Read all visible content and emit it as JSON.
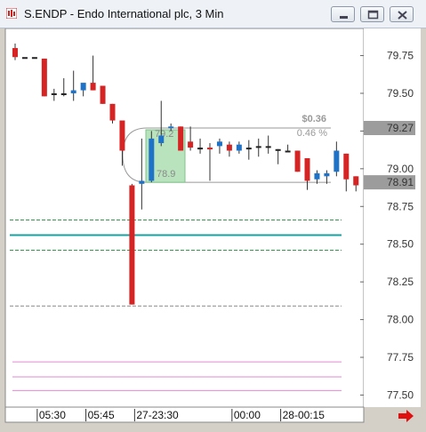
{
  "window": {
    "title": "S.ENDP - Endo International plc, 3 Min",
    "icon": "chart-app-icon",
    "buttons": [
      "minimize-icon",
      "maximize-icon",
      "close-icon"
    ]
  },
  "colors": {
    "up": "#1e73c9",
    "down": "#d62424",
    "neutral": "#222222",
    "green_band": "#2e9b4a",
    "teal": "#19a0a0",
    "pink": "#e28ad2",
    "gray_line": "#888888",
    "highlight_fill": "#b8e3bd"
  },
  "chart_data": {
    "type": "candlestick",
    "symbol": "S.ENDP",
    "interval": "3 Min",
    "ylim": [
      77.42,
      79.93
    ],
    "y_ticks": [
      "79.75",
      "79.50",
      "79.25",
      "79.00",
      "78.75",
      "78.50",
      "78.25",
      "78.00",
      "77.75",
      "77.50"
    ],
    "y_tick_values": [
      79.75,
      79.5,
      79.25,
      79.0,
      78.75,
      78.5,
      78.25,
      78.0,
      77.75,
      77.5
    ],
    "x_labels": [
      "05:30",
      "05:45",
      "27-23:30",
      "00:00",
      "28-00:15"
    ],
    "x_label_bars": [
      3,
      8,
      13,
      23,
      28
    ],
    "candles": [
      {
        "o": 79.8,
        "h": 79.83,
        "l": 79.72,
        "c": 79.74
      },
      {
        "o": 79.74,
        "h": 79.74,
        "l": 79.74,
        "c": 79.74
      },
      {
        "o": 79.74,
        "h": 79.74,
        "l": 79.74,
        "c": 79.74
      },
      {
        "o": 79.73,
        "h": 79.73,
        "l": 79.48,
        "c": 79.48
      },
      {
        "o": 79.5,
        "h": 79.53,
        "l": 79.45,
        "c": 79.5
      },
      {
        "o": 79.5,
        "h": 79.6,
        "l": 79.48,
        "c": 79.5
      },
      {
        "o": 79.5,
        "h": 79.65,
        "l": 79.45,
        "c": 79.52
      },
      {
        "o": 79.52,
        "h": 79.55,
        "l": 79.48,
        "c": 79.57
      },
      {
        "o": 79.57,
        "h": 79.75,
        "l": 79.52,
        "c": 79.52
      },
      {
        "o": 79.55,
        "h": 79.55,
        "l": 79.43,
        "c": 79.43
      },
      {
        "o": 79.43,
        "h": 79.43,
        "l": 79.3,
        "c": 79.32
      },
      {
        "o": 79.32,
        "h": 79.25,
        "l": 79.02,
        "c": 79.12
      },
      {
        "o": 78.89,
        "h": 78.9,
        "l": 78.1,
        "c": 78.1
      },
      {
        "o": 78.9,
        "h": 79.2,
        "l": 78.73,
        "c": 78.92
      },
      {
        "o": 78.92,
        "h": 79.25,
        "l": 78.91,
        "c": 79.2
      },
      {
        "o": 79.17,
        "h": 79.45,
        "l": 79.15,
        "c": 79.22
      },
      {
        "o": 79.27,
        "h": 79.3,
        "l": 79.25,
        "c": 79.28
      },
      {
        "o": 79.28,
        "h": 79.28,
        "l": 79.12,
        "c": 79.12
      },
      {
        "o": 79.18,
        "h": 79.28,
        "l": 79.12,
        "c": 79.14
      },
      {
        "o": 79.14,
        "h": 79.2,
        "l": 79.1,
        "c": 79.14
      },
      {
        "o": 79.14,
        "h": 79.17,
        "l": 78.92,
        "c": 79.13
      },
      {
        "o": 79.15,
        "h": 79.2,
        "l": 79.1,
        "c": 79.18
      },
      {
        "o": 79.16,
        "h": 79.18,
        "l": 79.08,
        "c": 79.12
      },
      {
        "o": 79.12,
        "h": 79.18,
        "l": 79.1,
        "c": 79.16
      },
      {
        "o": 79.14,
        "h": 79.19,
        "l": 79.06,
        "c": 79.14
      },
      {
        "o": 79.15,
        "h": 79.2,
        "l": 79.08,
        "c": 79.15
      },
      {
        "o": 79.15,
        "h": 79.22,
        "l": 79.1,
        "c": 79.15
      },
      {
        "o": 79.13,
        "h": 79.13,
        "l": 79.03,
        "c": 79.13
      },
      {
        "o": 79.12,
        "h": 79.16,
        "l": 79.12,
        "c": 79.12
      },
      {
        "o": 79.12,
        "h": 79.12,
        "l": 78.98,
        "c": 78.98
      },
      {
        "o": 79.07,
        "h": 79.07,
        "l": 78.86,
        "c": 78.92
      },
      {
        "o": 78.93,
        "h": 78.99,
        "l": 78.9,
        "c": 78.97
      },
      {
        "o": 78.95,
        "h": 78.99,
        "l": 78.9,
        "c": 78.97
      },
      {
        "o": 78.98,
        "h": 79.18,
        "l": 78.95,
        "c": 79.12
      },
      {
        "o": 79.1,
        "h": 79.1,
        "l": 78.85,
        "c": 78.93
      },
      {
        "o": 78.95,
        "h": 78.95,
        "l": 78.85,
        "c": 78.89
      }
    ],
    "horizontal_lines": [
      {
        "price": 78.66,
        "color": "green_band",
        "style": "dashed"
      },
      {
        "price": 78.56,
        "color": "teal",
        "style": "solid"
      },
      {
        "price": 78.46,
        "color": "green_band",
        "style": "dashed"
      },
      {
        "price": 78.09,
        "color": "gray_line",
        "style": "dashed"
      },
      {
        "price": 77.72,
        "color": "pink",
        "style": "solid"
      },
      {
        "price": 77.62,
        "color": "pink",
        "style": "solid"
      },
      {
        "price": 77.53,
        "color": "pink",
        "style": "solid"
      }
    ],
    "measure_box": {
      "top_price": 79.27,
      "bottom_price": 78.91,
      "change": "$0.36",
      "change_pct": "0.46 %",
      "top_label": "79.2",
      "bottom_label": "78.9"
    },
    "price_markers": [
      {
        "value": "79.27",
        "price": 79.27
      },
      {
        "value": "78.91",
        "price": 78.91
      }
    ]
  },
  "status_bar": {
    "scroll_arrow": "right-arrow-icon"
  }
}
